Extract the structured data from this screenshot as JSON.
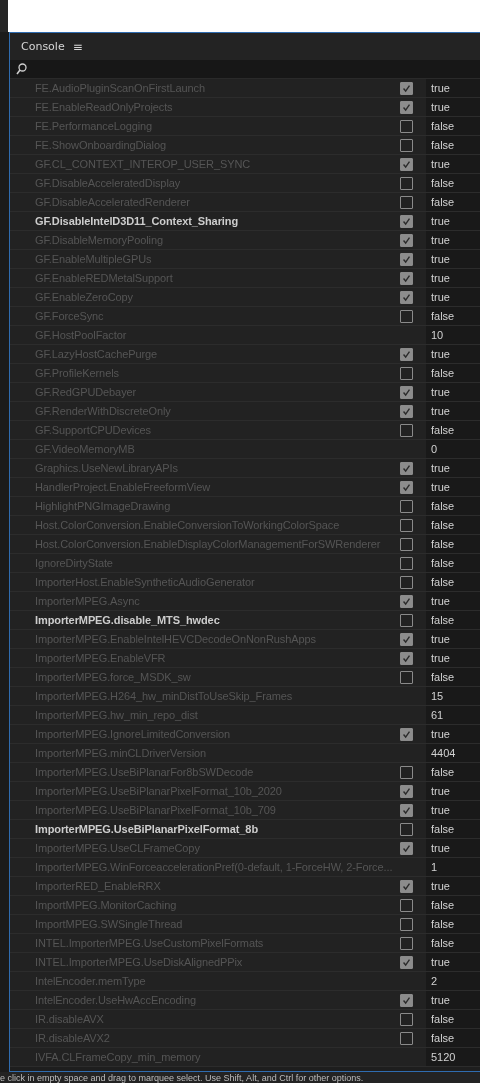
{
  "panel": {
    "title": "Console",
    "menu_glyph": "≡"
  },
  "rows": [
    {
      "name": "FE.AudioPluginScanOnFirstLaunch",
      "kind": "bool",
      "checked": true,
      "value": "true",
      "modified": false
    },
    {
      "name": "FE.EnableReadOnlyProjects",
      "kind": "bool",
      "checked": true,
      "value": "true",
      "modified": false
    },
    {
      "name": "FE.PerformanceLogging",
      "kind": "bool",
      "checked": false,
      "value": "false",
      "modified": false
    },
    {
      "name": "FE.ShowOnboardingDialog",
      "kind": "bool",
      "checked": false,
      "value": "false",
      "modified": false
    },
    {
      "name": "GF.CL_CONTEXT_INTEROP_USER_SYNC",
      "kind": "bool",
      "checked": true,
      "value": "true",
      "modified": false
    },
    {
      "name": "GF.DisableAcceleratedDisplay",
      "kind": "bool",
      "checked": false,
      "value": "false",
      "modified": false
    },
    {
      "name": "GF.DisableAcceleratedRenderer",
      "kind": "bool",
      "checked": false,
      "value": "false",
      "modified": false
    },
    {
      "name": "GF.DisableIntelD3D11_Context_Sharing",
      "kind": "bool",
      "checked": true,
      "value": "true",
      "modified": true
    },
    {
      "name": "GF.DisableMemoryPooling",
      "kind": "bool",
      "checked": true,
      "value": "true",
      "modified": false
    },
    {
      "name": "GF.EnableMultipleGPUs",
      "kind": "bool",
      "checked": true,
      "value": "true",
      "modified": false
    },
    {
      "name": "GF.EnableREDMetalSupport",
      "kind": "bool",
      "checked": true,
      "value": "true",
      "modified": false
    },
    {
      "name": "GF.EnableZeroCopy",
      "kind": "bool",
      "checked": true,
      "value": "true",
      "modified": false
    },
    {
      "name": "GF.ForceSync",
      "kind": "bool",
      "checked": false,
      "value": "false",
      "modified": false
    },
    {
      "name": "GF.HostPoolFactor",
      "kind": "number",
      "value": "10",
      "modified": false
    },
    {
      "name": "GF.LazyHostCachePurge",
      "kind": "bool",
      "checked": true,
      "value": "true",
      "modified": false
    },
    {
      "name": "GF.ProfileKernels",
      "kind": "bool",
      "checked": false,
      "value": "false",
      "modified": false
    },
    {
      "name": "GF.RedGPUDebayer",
      "kind": "bool",
      "checked": true,
      "value": "true",
      "modified": false
    },
    {
      "name": "GF.RenderWithDiscreteOnly",
      "kind": "bool",
      "checked": true,
      "value": "true",
      "modified": false
    },
    {
      "name": "GF.SupportCPUDevices",
      "kind": "bool",
      "checked": false,
      "value": "false",
      "modified": false
    },
    {
      "name": "GF.VideoMemoryMB",
      "kind": "number",
      "value": "0",
      "modified": false
    },
    {
      "name": "Graphics.UseNewLibraryAPIs",
      "kind": "bool",
      "checked": true,
      "value": "true",
      "modified": false
    },
    {
      "name": "HandlerProject.EnableFreeformView",
      "kind": "bool",
      "checked": true,
      "value": "true",
      "modified": false
    },
    {
      "name": "HighlightPNGImageDrawing",
      "kind": "bool",
      "checked": false,
      "value": "false",
      "modified": false
    },
    {
      "name": "Host.ColorConversion.EnableConversionToWorkingColorSpace",
      "kind": "bool",
      "checked": false,
      "value": "false",
      "modified": false
    },
    {
      "name": "Host.ColorConversion.EnableDisplayColorManagementForSWRenderer",
      "kind": "bool",
      "checked": false,
      "value": "false",
      "modified": false
    },
    {
      "name": "IgnoreDirtyState",
      "kind": "bool",
      "checked": false,
      "value": "false",
      "modified": false
    },
    {
      "name": "ImporterHost.EnableSyntheticAudioGenerator",
      "kind": "bool",
      "checked": false,
      "value": "false",
      "modified": false
    },
    {
      "name": "ImporterMPEG.Async",
      "kind": "bool",
      "checked": true,
      "value": "true",
      "modified": false
    },
    {
      "name": "ImporterMPEG.disable_MTS_hwdec",
      "kind": "bool",
      "checked": false,
      "value": "false",
      "modified": true
    },
    {
      "name": "ImporterMPEG.EnableIntelHEVCDecodeOnNonRushApps",
      "kind": "bool",
      "checked": true,
      "value": "true",
      "modified": false
    },
    {
      "name": "ImporterMPEG.EnableVFR",
      "kind": "bool",
      "checked": true,
      "value": "true",
      "modified": false
    },
    {
      "name": "ImporterMPEG.force_MSDK_sw",
      "kind": "bool",
      "checked": false,
      "value": "false",
      "modified": false
    },
    {
      "name": "ImporterMPEG.H264_hw_minDistToUseSkip_Frames",
      "kind": "number",
      "value": "15",
      "modified": false
    },
    {
      "name": "ImporterMPEG.hw_min_repo_dist",
      "kind": "number",
      "value": "61",
      "modified": false
    },
    {
      "name": "ImporterMPEG.IgnoreLimitedConversion",
      "kind": "bool",
      "checked": true,
      "value": "true",
      "modified": false
    },
    {
      "name": "ImporterMPEG.minCLDriverVersion",
      "kind": "number",
      "value": "4404",
      "modified": false
    },
    {
      "name": "ImporterMPEG.UseBiPlanarFor8bSWDecode",
      "kind": "bool",
      "checked": false,
      "value": "false",
      "modified": false
    },
    {
      "name": "ImporterMPEG.UseBiPlanarPixelFormat_10b_2020",
      "kind": "bool",
      "checked": true,
      "value": "true",
      "modified": false
    },
    {
      "name": "ImporterMPEG.UseBiPlanarPixelFormat_10b_709",
      "kind": "bool",
      "checked": true,
      "value": "true",
      "modified": false
    },
    {
      "name": "ImporterMPEG.UseBiPlanarPixelFormat_8b",
      "kind": "bool",
      "checked": false,
      "value": "false",
      "modified": true
    },
    {
      "name": "ImporterMPEG.UseCLFrameCopy",
      "kind": "bool",
      "checked": true,
      "value": "true",
      "modified": false
    },
    {
      "name": "ImporterMPEG.WinForceaccelerationPref(0-default, 1-ForceHW, 2-Force...",
      "kind": "number",
      "value": "1",
      "modified": false
    },
    {
      "name": "ImporterRED_EnableRRX",
      "kind": "bool",
      "checked": true,
      "value": "true",
      "modified": false
    },
    {
      "name": "ImportMPEG.MonitorCaching",
      "kind": "bool",
      "checked": false,
      "value": "false",
      "modified": false
    },
    {
      "name": "ImportMPEG.SWSingleThread",
      "kind": "bool",
      "checked": false,
      "value": "false",
      "modified": false
    },
    {
      "name": "INTEL.ImporterMPEG.UseCustomPixelFormats",
      "kind": "bool",
      "checked": false,
      "value": "false",
      "modified": false
    },
    {
      "name": "INTEL.ImporterMPEG.UseDiskAlignedPPix",
      "kind": "bool",
      "checked": true,
      "value": "true",
      "modified": false
    },
    {
      "name": "IntelEncoder.memType",
      "kind": "number",
      "value": "2",
      "modified": false
    },
    {
      "name": "IntelEncoder.UseHwAccEncoding",
      "kind": "bool",
      "checked": true,
      "value": "true",
      "modified": false
    },
    {
      "name": "IR.disableAVX",
      "kind": "bool",
      "checked": false,
      "value": "false",
      "modified": false
    },
    {
      "name": "IR.disableAVX2",
      "kind": "bool",
      "checked": false,
      "value": "false",
      "modified": false
    },
    {
      "name": "IVFA.CLFrameCopy_min_memory",
      "kind": "number",
      "value": "5120",
      "modified": false
    }
  ],
  "status_bar": "e click in empty space and drag to marquee select. Use Shift, Alt, and Ctrl for other options."
}
